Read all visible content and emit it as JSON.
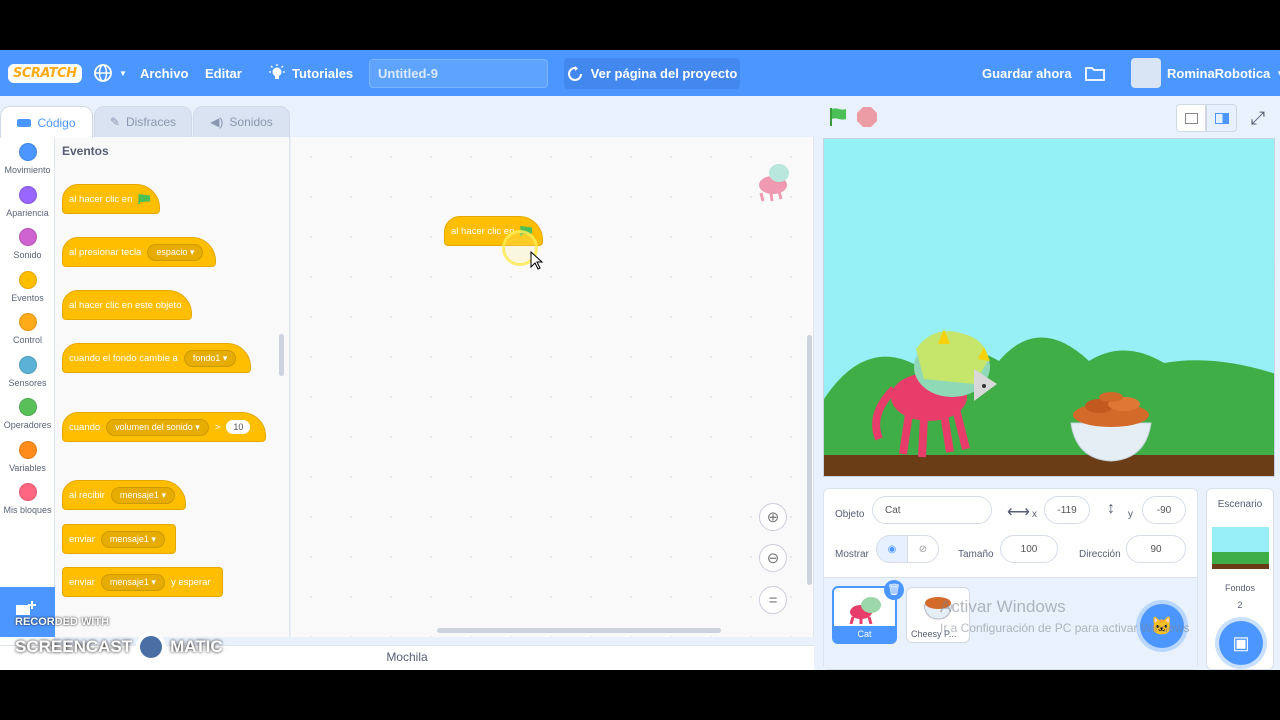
{
  "header": {
    "logo": "SCRATCH",
    "file": "Archivo",
    "edit": "Editar",
    "tutorials": "Tutoriales",
    "project_title": "Untitled-9",
    "see_project": "Ver página del proyecto",
    "save_now": "Guardar ahora",
    "username": "RominaRobotica"
  },
  "tabs": {
    "code": "Código",
    "costumes": "Disfraces",
    "sounds": "Sonidos"
  },
  "categories": [
    {
      "label": "Movimiento",
      "color": "#4c97ff"
    },
    {
      "label": "Apariencia",
      "color": "#9966ff"
    },
    {
      "label": "Sonido",
      "color": "#cf63cf"
    },
    {
      "label": "Eventos",
      "color": "#ffbf00"
    },
    {
      "label": "Control",
      "color": "#ffab19"
    },
    {
      "label": "Sensores",
      "color": "#5cb1d6"
    },
    {
      "label": "Operadores",
      "color": "#59c059"
    },
    {
      "label": "Variables",
      "color": "#ff8c1a"
    },
    {
      "label": "Mis bloques",
      "color": "#ff6680"
    }
  ],
  "palette": {
    "heading": "Eventos",
    "b1": "al hacer clic en",
    "b2": "al presionar tecla",
    "b2_dd": "espacio",
    "b3": "al hacer clic en este objeto",
    "b4": "cuando el fondo cambie a",
    "b4_dd": "fondo1",
    "b5": "cuando",
    "b5_dd": "volumen del sonido",
    "b5_op": ">",
    "b5_val": "10",
    "b6": "al recibir",
    "b6_dd": "mensaje1",
    "b7": "enviar",
    "b7_dd": "mensaje1",
    "b8": "enviar",
    "b8_dd": "mensaje1",
    "b8_tail": "y esperar"
  },
  "workspace": {
    "block": "al hacer clic en"
  },
  "backpack": "Mochila",
  "sprite_info": {
    "sprite_label": "Objeto",
    "sprite_name": "Cat",
    "x_label": "x",
    "x": "-119",
    "y_label": "y",
    "y": "-90",
    "show_label": "Mostrar",
    "size_label": "Tamaño",
    "size": "100",
    "direction_label": "Dirección",
    "direction": "90"
  },
  "sprites": [
    {
      "name": "Cat"
    },
    {
      "name": "Cheesy P..."
    }
  ],
  "stage_panel": {
    "title": "Escenario",
    "backdrops_label": "Fondos",
    "backdrops_count": "2"
  },
  "watermark": {
    "line1": "Activar Windows",
    "line2": "Ir a Configuración de PC para activar Windows"
  },
  "recorder": {
    "line1": "RECORDED WITH",
    "line2": "SCREENCAST",
    "line3": "MATIC"
  },
  "colors": {
    "topbar": "#4c97ff",
    "events": "#ffbf00"
  }
}
